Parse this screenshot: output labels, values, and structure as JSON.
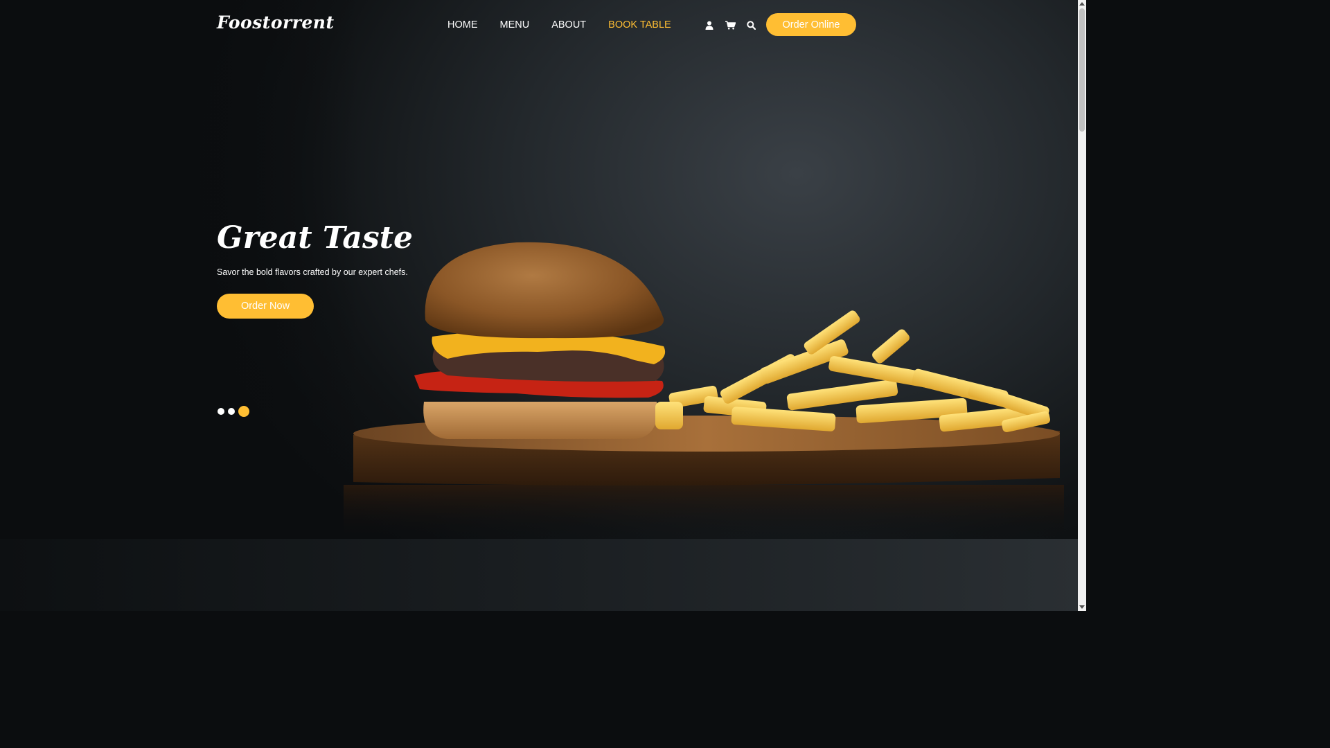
{
  "header": {
    "logo": "Foostorrent",
    "nav": [
      {
        "label": "HOME",
        "active": false
      },
      {
        "label": "MENU",
        "active": false
      },
      {
        "label": "ABOUT",
        "active": false
      },
      {
        "label": "BOOK TABLE",
        "active": true
      }
    ],
    "icons": [
      "user-icon",
      "cart-icon",
      "search-icon"
    ],
    "order_online_label": "Order Online"
  },
  "hero": {
    "title": "Great Taste",
    "subtitle": "Savor the bold flavors crafted by our expert chefs.",
    "order_now_label": "Order Now",
    "slides": {
      "count": 3,
      "active_index": 2
    },
    "image_subject": "burger-and-fries"
  },
  "colors": {
    "accent": "#ffbe33",
    "text": "#ffffff",
    "background": "#0b0d0f"
  }
}
